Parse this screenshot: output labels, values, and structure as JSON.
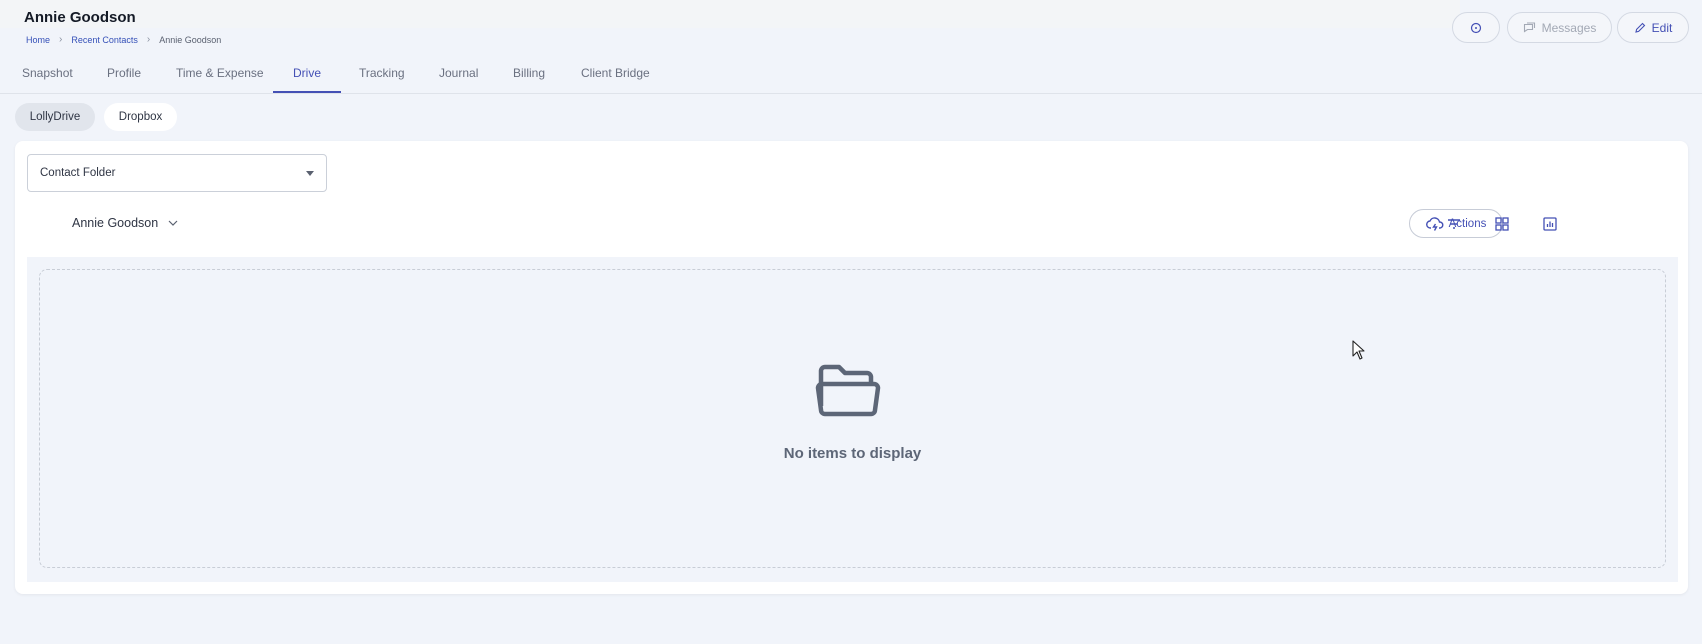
{
  "header": {
    "title": "Annie Goodson",
    "breadcrumb": [
      "Home",
      "Recent Contacts",
      "Annie Goodson"
    ],
    "buttons": {
      "messages": "Messages",
      "edit": "Edit"
    }
  },
  "tabs": [
    "Snapshot",
    "Profile",
    "Time & Expense",
    "Drive",
    "Tracking",
    "Journal",
    "Billing",
    "Client Bridge"
  ],
  "active_tab": "Drive",
  "drive_sources": [
    "LollyDrive",
    "Dropbox"
  ],
  "active_source": "LollyDrive",
  "folder_select": {
    "value": "Contact Folder"
  },
  "owner": "Annie Goodson",
  "toolbar": {
    "actions_label": "Actions"
  },
  "empty_state": {
    "message": "No items to display"
  },
  "colors": {
    "accent": "#4450b5",
    "background": "#f1f4fa",
    "card": "#ffffff"
  }
}
